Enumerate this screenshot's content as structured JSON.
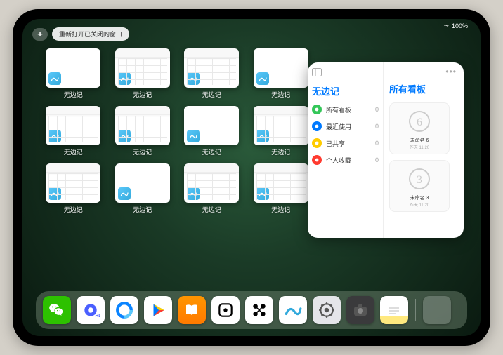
{
  "status": {
    "signal": "▁▃▅",
    "battery": "100%",
    "wifi": "⏦"
  },
  "topbar": {
    "plus_label": "+",
    "reopen_label": "重新打开已关闭的窗口"
  },
  "windows": [
    {
      "label": "无边记",
      "type": "a"
    },
    {
      "label": "无边记",
      "type": "b"
    },
    {
      "label": "无边记",
      "type": "b"
    },
    {
      "label": "无边记",
      "type": "a"
    },
    {
      "label": "无边记",
      "type": "b"
    },
    {
      "label": "无边记",
      "type": "b"
    },
    {
      "label": "无边记",
      "type": "a"
    },
    {
      "label": "无边记",
      "type": "b"
    },
    {
      "label": "无边记",
      "type": "b"
    },
    {
      "label": "无边记",
      "type": "a"
    },
    {
      "label": "无边记",
      "type": "b"
    },
    {
      "label": "无边记",
      "type": "b"
    }
  ],
  "widget": {
    "left_title": "无边记",
    "right_title": "所有看板",
    "items": [
      {
        "label": "所有看板",
        "count": "0",
        "color": "#34c759"
      },
      {
        "label": "最近使用",
        "count": "0",
        "color": "#007aff"
      },
      {
        "label": "已共享",
        "count": "0",
        "color": "#ffcc00"
      },
      {
        "label": "个人收藏",
        "count": "0",
        "color": "#ff3b30"
      }
    ],
    "boards": [
      {
        "label": "未命名 6",
        "sub": "昨天 11:20",
        "glyph": "6"
      },
      {
        "label": "未命名 3",
        "sub": "昨天 11:20",
        "glyph": "3"
      }
    ],
    "dots": "•••"
  },
  "dock": {
    "icons": [
      {
        "name": "wechat",
        "bg": "#2dc100",
        "glyph_color": "#fff"
      },
      {
        "name": "quark",
        "bg": "#ffffff"
      },
      {
        "name": "browser",
        "bg": "#ffffff"
      },
      {
        "name": "play",
        "bg": "#ffffff"
      },
      {
        "name": "books",
        "bg": "linear-gradient(#ff9500,#ff7a00)",
        "glyph_color": "#fff"
      },
      {
        "name": "dice",
        "bg": "#ffffff"
      },
      {
        "name": "connect",
        "bg": "#ffffff"
      },
      {
        "name": "freeform",
        "bg": "#ffffff"
      },
      {
        "name": "settings",
        "bg": "#e5e5ea"
      },
      {
        "name": "camera",
        "bg": "#3a3a3c"
      },
      {
        "name": "notes",
        "bg": "linear-gradient(#fff 70%,#ffe97f 70%)"
      }
    ],
    "recent": {
      "name": "app-library"
    }
  }
}
